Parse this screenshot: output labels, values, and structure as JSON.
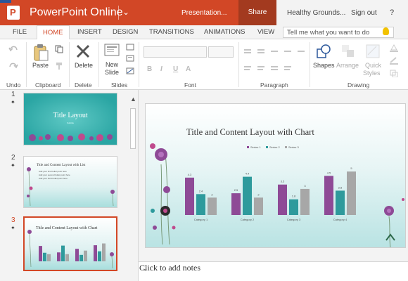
{
  "app": {
    "name": "PowerPoint Online",
    "document": "Presentation...",
    "share_label": "Share",
    "user": "Healthy Grounds...",
    "signout_label": "Sign out",
    "help_label": "?"
  },
  "tabs": [
    "FILE",
    "HOME",
    "INSERT",
    "DESIGN",
    "TRANSITIONS",
    "ANIMATIONS",
    "VIEW"
  ],
  "active_tab": "HOME",
  "tell_me_placeholder": "Tell me what you want to do",
  "ribbon": {
    "undo_group": "Undo",
    "clipboard_group": "Clipboard",
    "paste_label": "Paste",
    "delete_group": "Delete",
    "delete_label": "Delete",
    "slides_group": "Slides",
    "new_slide_label_1": "New",
    "new_slide_label_2": "Slide",
    "font_group": "Font",
    "paragraph_group": "Paragraph",
    "drawing_group": "Drawing",
    "shapes_label": "Shapes",
    "arrange_label": "Arrange",
    "quick_styles_label_1": "Quick",
    "quick_styles_label_2": "Styles",
    "font_format_buttons": [
      "B",
      "I",
      "U",
      "A"
    ]
  },
  "slides": [
    {
      "number": "1",
      "title": "Title Layout",
      "subtitle": "Subtitle"
    },
    {
      "number": "2",
      "title": "Title and Content Layout with List",
      "bullets": [
        "Add your first bullet point here",
        "Add your second bullet point here",
        "Add your third bullet point here"
      ]
    },
    {
      "number": "3",
      "title": "Title and Content Layout with Chart"
    }
  ],
  "active_slide": "3",
  "main_slide": {
    "title": "Title and Content Layout with Chart"
  },
  "notes_placeholder": "Click to add notes",
  "colors": {
    "accent": "#d24726",
    "series1": "#8e4a96",
    "series2": "#2e9a9c",
    "series3": "#a7a7a7"
  },
  "chart_data": {
    "type": "bar",
    "categories": [
      "Category 1",
      "Category 2",
      "Category 3",
      "Category 4"
    ],
    "series": [
      {
        "name": "Series 1",
        "values": [
          4.3,
          2.5,
          3.5,
          4.5
        ]
      },
      {
        "name": "Series 2",
        "values": [
          2.4,
          4.4,
          1.8,
          2.8
        ]
      },
      {
        "name": "Series 3",
        "values": [
          2,
          2,
          3,
          5
        ]
      }
    ],
    "title": "",
    "ylim": [
      0,
      5.5
    ],
    "grid": false,
    "legend": "top"
  }
}
